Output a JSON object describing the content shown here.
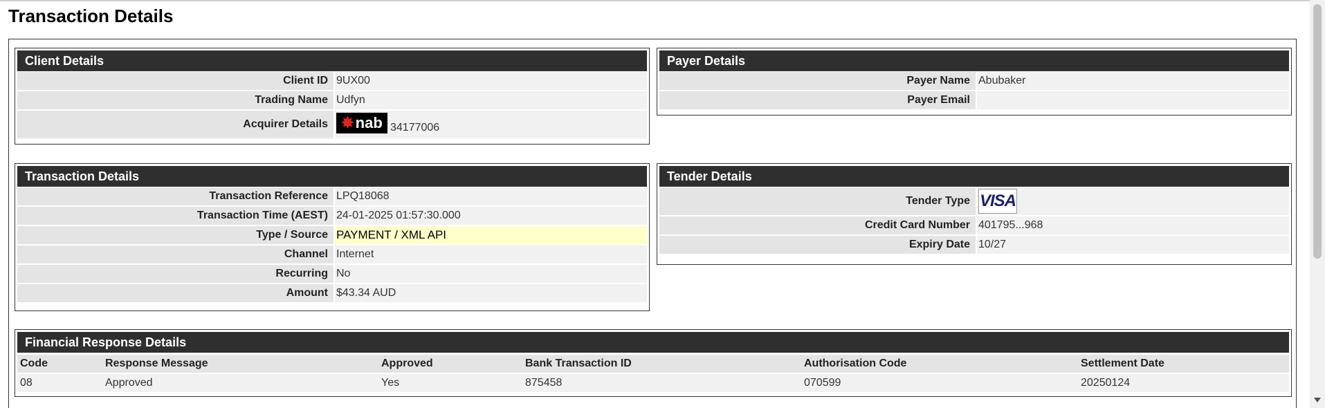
{
  "page": {
    "title": "Transaction Details"
  },
  "client": {
    "header": "Client Details",
    "rows": [
      {
        "label": "Client ID",
        "value": "9UX00"
      },
      {
        "label": "Trading Name",
        "value": "Udfyn"
      },
      {
        "label": "Acquirer Details",
        "logo_text": "nab",
        "value": "34177006"
      }
    ]
  },
  "payer": {
    "header": "Payer Details",
    "rows": [
      {
        "label": "Payer Name",
        "value": "Abubaker"
      },
      {
        "label": "Payer Email",
        "value": ""
      }
    ]
  },
  "transaction": {
    "header": "Transaction Details",
    "rows": [
      {
        "label": "Transaction Reference",
        "value": "LPQ18068"
      },
      {
        "label": "Transaction Time (AEST)",
        "value": "24-01-2025 01:57:30.000"
      },
      {
        "label": "Type / Source",
        "value": "PAYMENT / XML API"
      },
      {
        "label": "Channel",
        "value": "Internet"
      },
      {
        "label": "Recurring",
        "value": "No"
      },
      {
        "label": "Amount",
        "value": "$43.34 AUD"
      }
    ],
    "highlight_color": "#ffffcc"
  },
  "tender": {
    "header": "Tender Details",
    "rows": [
      {
        "label": "Tender Type",
        "logo_text": "VISA"
      },
      {
        "label": "Credit Card Number",
        "value": "401795...968"
      },
      {
        "label": "Expiry Date",
        "value": "10/27"
      }
    ]
  },
  "financial": {
    "header": "Financial Response Details",
    "columns": [
      "Code",
      "Response Message",
      "Approved",
      "Bank Transaction ID",
      "Authorisation Code",
      "Settlement Date"
    ],
    "rows": [
      [
        "08",
        "Approved",
        "Yes",
        "875458",
        "070599",
        "20250124"
      ]
    ]
  },
  "colors": {
    "header_bg": "#2f2f2f",
    "label_bg": "#e4e4e4",
    "value_bg": "#f1f1f1"
  }
}
